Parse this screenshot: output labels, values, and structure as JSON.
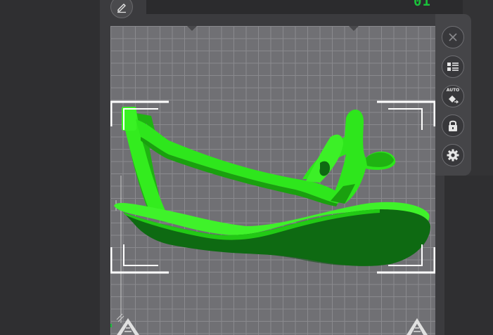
{
  "header": {
    "plate_counter": "01"
  },
  "toolbar": {
    "buttons": [
      {
        "id": "close",
        "icon": "close-icon",
        "label": ""
      },
      {
        "id": "layout",
        "icon": "list-icon",
        "label": ""
      },
      {
        "id": "auto",
        "icon": "auto-orient-icon",
        "label": "AUTO"
      },
      {
        "id": "lock",
        "icon": "lock-icon",
        "label": ""
      },
      {
        "id": "settings",
        "icon": "gear-icon",
        "label": ""
      }
    ]
  },
  "scene": {
    "model": "3d-model-green",
    "model_color": "#2ee61c",
    "model_shadow_color": "#0e6a12",
    "grid_color": "#707074",
    "accent": "#19c23a"
  }
}
